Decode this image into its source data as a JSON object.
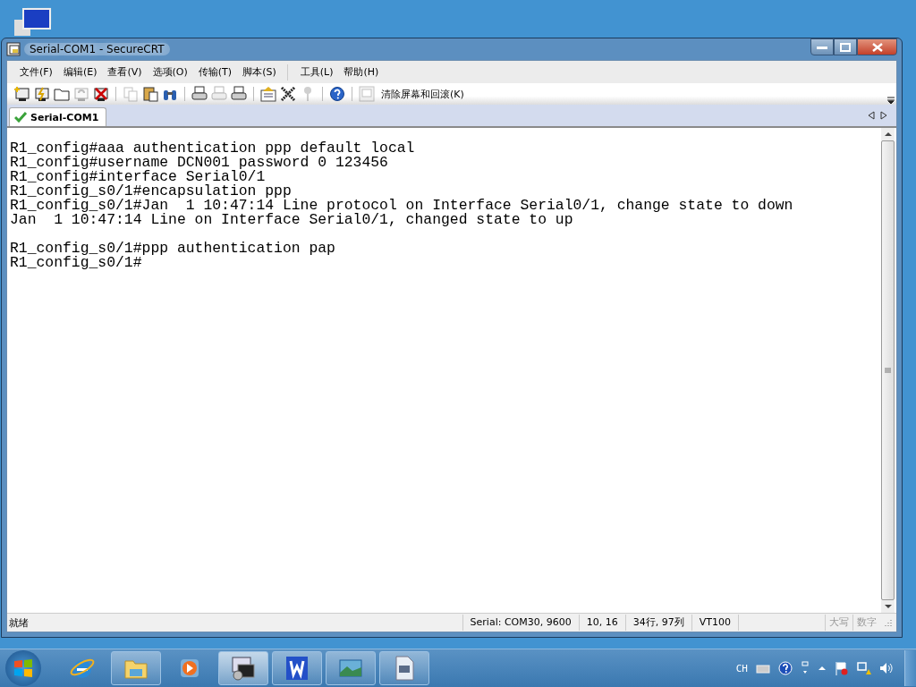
{
  "window": {
    "title": "Serial-COM1 - SecureCRT"
  },
  "menu": [
    "文件(F)",
    "编辑(E)",
    "查看(V)",
    "选项(O)",
    "传输(T)",
    "脚本(S)",
    "工具(L)",
    "帮助(H)"
  ],
  "toolbar": {
    "icons": [
      {
        "kind": "connect",
        "disabled": false
      },
      {
        "kind": "quick",
        "disabled": false
      },
      {
        "kind": "folder",
        "disabled": false
      },
      {
        "kind": "reconnect",
        "disabled": true
      },
      {
        "kind": "disconnect",
        "disabled": false
      },
      {
        "kind": "sep"
      },
      {
        "kind": "copy",
        "disabled": true
      },
      {
        "kind": "paste",
        "disabled": false
      },
      {
        "kind": "find",
        "disabled": false
      },
      {
        "kind": "sep"
      },
      {
        "kind": "printer",
        "disabled": false
      },
      {
        "kind": "printer",
        "disabled": true
      },
      {
        "kind": "printer",
        "disabled": false
      },
      {
        "kind": "sep"
      },
      {
        "kind": "options",
        "disabled": false
      },
      {
        "kind": "keymap",
        "disabled": false
      },
      {
        "kind": "key",
        "disabled": true
      },
      {
        "kind": "sep"
      },
      {
        "kind": "help",
        "disabled": false
      },
      {
        "kind": "sep"
      },
      {
        "kind": "clear",
        "disabled": true
      }
    ],
    "clear_label": "清除屏幕和回滚(K)"
  },
  "tabs": [
    {
      "label": "Serial-COM1",
      "connected": true,
      "selected": true
    }
  ],
  "terminal": {
    "blocks": [
      [
        "R1_config#aaa authentication ppp default local",
        "R1_config#username DCN001 password 0 123456",
        "R1_config#interface Serial0/1",
        "R1_config_s0/1#encapsulation ppp",
        "R1_config_s0/1#Jan  1 10:47:14 Line protocol on Interface Serial0/1, change state to down",
        "Jan  1 10:47:14 Line on Interface Serial0/1, changed state to up"
      ],
      [
        "R1_config_s0/1#ppp authentication pap",
        "R1_config_s0/1#"
      ]
    ]
  },
  "status_bar": {
    "message": "就绪",
    "fields": [
      "Serial: COM30, 9600",
      "10, 16",
      "34行, 97列",
      "VT100"
    ],
    "indicators": [
      {
        "label": "大写",
        "active": false
      },
      {
        "label": "数字",
        "active": false
      }
    ]
  },
  "taskbar": {
    "items": [
      {
        "kind": "browser",
        "running": false,
        "selected": false
      },
      {
        "kind": "folder",
        "running": true,
        "selected": false
      },
      {
        "kind": "media",
        "running": false,
        "selected": false
      },
      {
        "kind": "terminal",
        "running": true,
        "selected": true
      },
      {
        "kind": "writer",
        "running": true,
        "selected": false
      },
      {
        "kind": "photo",
        "running": true,
        "selected": false
      },
      {
        "kind": "document",
        "running": true,
        "selected": false
      }
    ],
    "language": "CH"
  }
}
